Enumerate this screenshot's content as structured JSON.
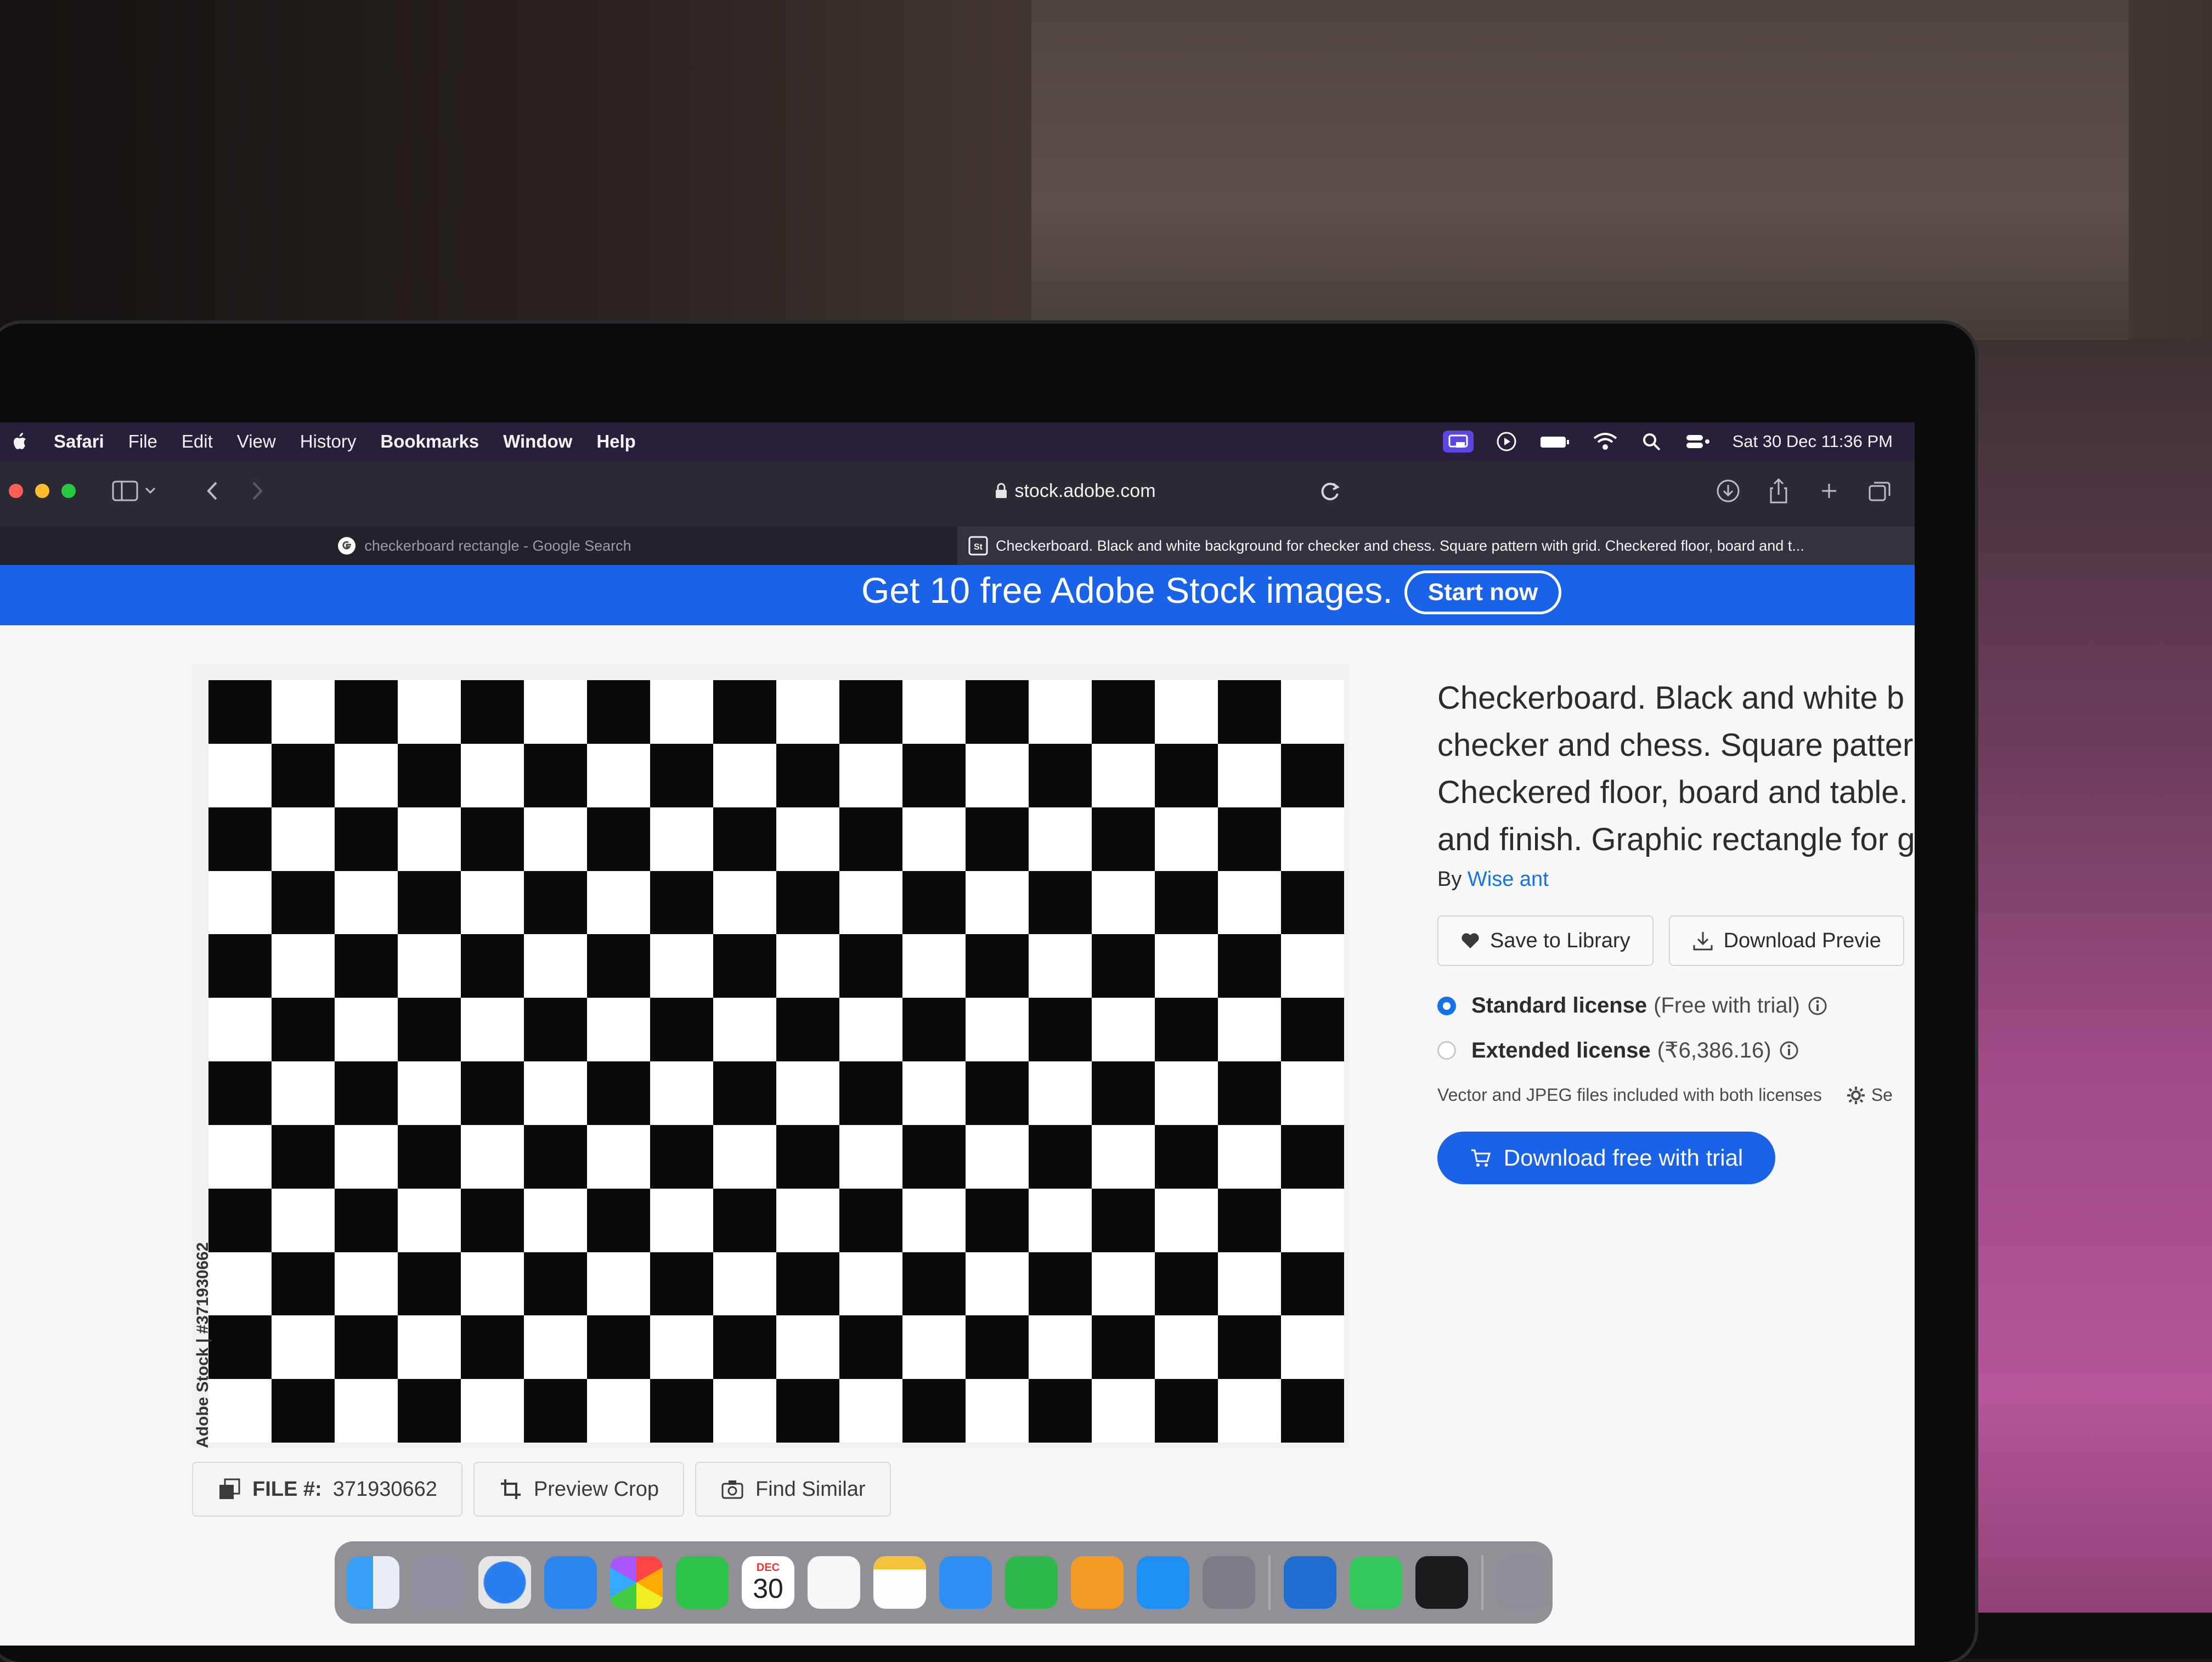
{
  "menubar": {
    "app": "Safari",
    "items": [
      "File",
      "Edit",
      "View",
      "History",
      "Bookmarks",
      "Window",
      "Help"
    ],
    "datetime": "Sat 30 Dec  11:36 PM"
  },
  "toolbar": {
    "url": "stock.adobe.com"
  },
  "tabs": [
    {
      "label": "checkerboard rectangle - Google Search",
      "favicon": "google-icon",
      "active": false
    },
    {
      "label": "Checkerboard. Black and white background for checker and chess. Square pattern with grid. Checkered floor, board and t...",
      "favicon": "adobe-stock-icon",
      "active": true
    }
  ],
  "banner": {
    "text": "Get 10 free Adobe Stock images.",
    "button": "Start now"
  },
  "image": {
    "watermark": "Adobe Stock | #371930662"
  },
  "info": {
    "title_lines": [
      "Checkerboard. Black and white b",
      "checker and chess. Square patter",
      "Checkered floor, board and table.",
      "and finish. Graphic rectangle for g"
    ],
    "by_prefix": "By",
    "author": "Wise ant",
    "save_label": "Save to Library",
    "download_preview_label": "Download Previe",
    "licenses": [
      {
        "name": "Standard license",
        "note": "(Free with trial)",
        "selected": true
      },
      {
        "name": "Extended license",
        "note": "(₹6,386.16)",
        "selected": false
      }
    ],
    "vector_note": "Vector and JPEG files included with both licenses",
    "settings_partial": "Se",
    "cta": "Download free with trial"
  },
  "bottom": {
    "file_label": "FILE #:",
    "file_number": "371930662",
    "preview_crop": "Preview Crop",
    "find_similar": "Find Similar"
  },
  "dock": {
    "calendar_month": "DEC",
    "calendar_day": "30"
  },
  "colors": {
    "accent": "#1473e6",
    "banner": "#1a63e8",
    "menubar": "#2a1f3a"
  }
}
